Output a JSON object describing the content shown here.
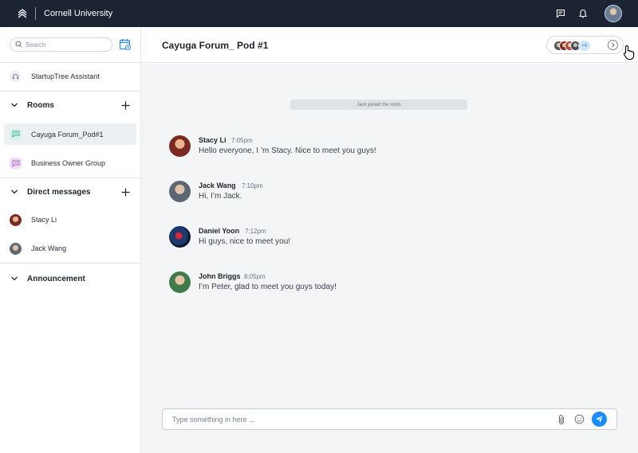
{
  "app": {
    "brand": "Cornell University"
  },
  "sidebar": {
    "search_placeholder": "Search",
    "assistant_label": "StartupTree Assistant",
    "rooms_label": "Rooms",
    "rooms": [
      {
        "label": "Cayuga Forum_Pod#1",
        "icon": "chat-icon",
        "icon_color": "#2fb39a",
        "active": true
      },
      {
        "label": "Business Owner Group",
        "icon": "chat-icon",
        "icon_color": "#a659c9",
        "active": false
      }
    ],
    "dm_label": "Direct messages",
    "dms": [
      {
        "label": "Stacy Li"
      },
      {
        "label": "Jack Wang"
      }
    ],
    "announcement_label": "Announcement"
  },
  "chat": {
    "title": "Cayuga Forum_ Pod #1",
    "members_more": "+4",
    "system_note": "Jack joined the room",
    "messages": [
      {
        "name": "Stacy Li",
        "time": "7:05pm",
        "text": "Hello everyone, I ’m Stacy. Nice to meet you guys!"
      },
      {
        "name": "Jack Wang",
        "time": "7:10pm",
        "text": "Hi, I’m Jack."
      },
      {
        "name": "Daniel Yoon",
        "time": "7:12pm",
        "text": "Hi guys, nice to meet you!"
      },
      {
        "name": "John Briggs",
        "time": "8:05pm",
        "text": "I’m Peter, glad to meet you guys today!"
      }
    ],
    "composer_placeholder": "Type something in here ..."
  },
  "colors": {
    "topbar": "#1c2434",
    "accent": "#1a8cff",
    "chat_bg": "#f4f5f7"
  }
}
